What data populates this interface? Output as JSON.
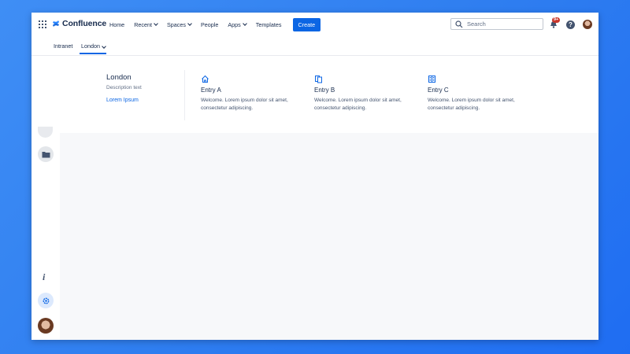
{
  "topnav": {
    "logo_text": "Confluence",
    "items": [
      {
        "label": "Home",
        "dropdown": false
      },
      {
        "label": "Recent",
        "dropdown": true
      },
      {
        "label": "Spaces",
        "dropdown": true
      },
      {
        "label": "People",
        "dropdown": false
      },
      {
        "label": "Apps",
        "dropdown": true
      },
      {
        "label": "Templates",
        "dropdown": false
      }
    ],
    "create_label": "Create",
    "search_placeholder": "Search",
    "notification_badge": "9+",
    "help_label": "?"
  },
  "subnav": {
    "tabs": [
      {
        "label": "Intranet"
      },
      {
        "label": "London"
      }
    ],
    "active_tab": "London"
  },
  "dropdown": {
    "title": "London",
    "description": "Description text",
    "link": "Lorem Ipsum",
    "entries": [
      {
        "icon": "home-icon",
        "title": "Entry A",
        "description": "Welcome. Lorem ipsum dolor sit amet, consectetur adipiscing."
      },
      {
        "icon": "pages-icon",
        "title": "Entry B",
        "description": "Welcome. Lorem ipsum dolor sit amet, consectetur adipiscing."
      },
      {
        "icon": "building-icon",
        "title": "Entry C",
        "description": "Welcome. Lorem ipsum dolor sit amet, consectetur adipiscing."
      }
    ]
  },
  "rail": {
    "info_label": "i",
    "icons": [
      "folder-icon",
      "info-icon",
      "settings-icon",
      "avatar"
    ]
  },
  "colors": {
    "brand_blue": "#0c66e4",
    "text": "#172b4d",
    "subtle_text": "#626f86",
    "badge_red": "#c9372c",
    "background_gradient": "#2f7ef0"
  }
}
